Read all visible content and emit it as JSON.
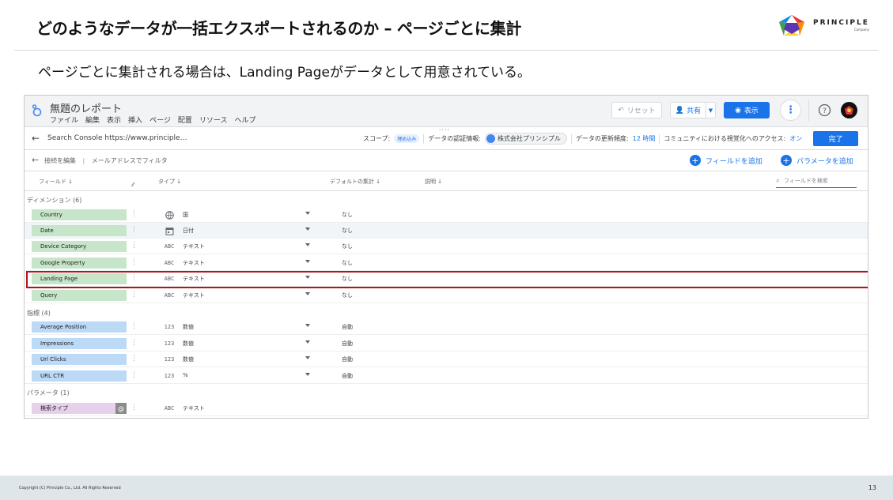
{
  "slide": {
    "title": "どのようなデータが一括エクスポートされるのか – ページごとに集計",
    "subtitle": "ページごとに集計される場合は、Landing Pageがデータとして用意されている。",
    "logo_name": "PRINCIPLE",
    "logo_sub": "Company",
    "copyright": "Copyright (C) Principle Co., Ltd. All Rights Reserved",
    "page_number": "13"
  },
  "app": {
    "report_title": "無題のレポート",
    "menu": [
      "ファイル",
      "編集",
      "表示",
      "挿入",
      "ページ",
      "配置",
      "リソース",
      "ヘルプ"
    ],
    "reset_label": "リセット",
    "share_label": "共有",
    "view_label": "表示",
    "more_label": "⋮",
    "ds_handle": "····",
    "data_source": "Search Console https://www.principle…",
    "scope_label": "スコープ:",
    "scope_value": "埋め込み",
    "credentials_label": "データの認証情報:",
    "owner": "株式会社プリンシプル",
    "refresh_label": "データの更新頻度:",
    "refresh_value": "12 時間",
    "community_label": "コミュニティにおける視覚化へのアクセス:",
    "community_value": "オン",
    "done_label": "完了",
    "edit_connection": "接続を編集",
    "edit_separator": "|",
    "filter_label": "メールアドレスでフィルタ",
    "add_field": "フィールドを追加",
    "add_parameter": "パラメータを追加"
  },
  "columns": {
    "field": "フィールド",
    "type": "タイプ",
    "default_agg": "デフォルトの集計",
    "description": "説明",
    "search_placeholder": "フィールドを検索"
  },
  "sections": {
    "dimensions": "ディメンション (6)",
    "metrics": "指標 (4)",
    "parameters": "パラメータ (1)"
  },
  "dimensions": [
    {
      "name": "Country",
      "type_icon": "globe-icon",
      "type": "国",
      "agg": "なし"
    },
    {
      "name": "Date",
      "type_icon": "calendar-icon",
      "type": "日付",
      "agg": "なし"
    },
    {
      "name": "Device Category",
      "type_icon": "ABC",
      "type": "テキスト",
      "agg": "なし"
    },
    {
      "name": "Google Property",
      "type_icon": "ABC",
      "type": "テキスト",
      "agg": "なし"
    },
    {
      "name": "Landing Page",
      "type_icon": "ABC",
      "type": "テキスト",
      "agg": "なし"
    },
    {
      "name": "Query",
      "type_icon": "ABC",
      "type": "テキスト",
      "agg": "なし"
    }
  ],
  "metrics": [
    {
      "name": "Average Position",
      "type_icon": "123",
      "type": "数値",
      "agg": "自動"
    },
    {
      "name": "Impressions",
      "type_icon": "123",
      "type": "数値",
      "agg": "自動"
    },
    {
      "name": "Url Clicks",
      "type_icon": "123",
      "type": "数値",
      "agg": "自動"
    },
    {
      "name": "URL CTR",
      "type_icon": "123",
      "type": "%",
      "agg": "自動"
    }
  ],
  "parameters": [
    {
      "name": "検索タイプ",
      "badge": "@",
      "type_icon": "ABC",
      "type": "テキスト"
    }
  ],
  "colors": {
    "accent": "#1a73e8",
    "dimension_chip": "#c7e5c9",
    "metric_chip": "#bcd9f6",
    "parameter_chip": "#e6d0ec",
    "highlight": "#b3141e"
  }
}
